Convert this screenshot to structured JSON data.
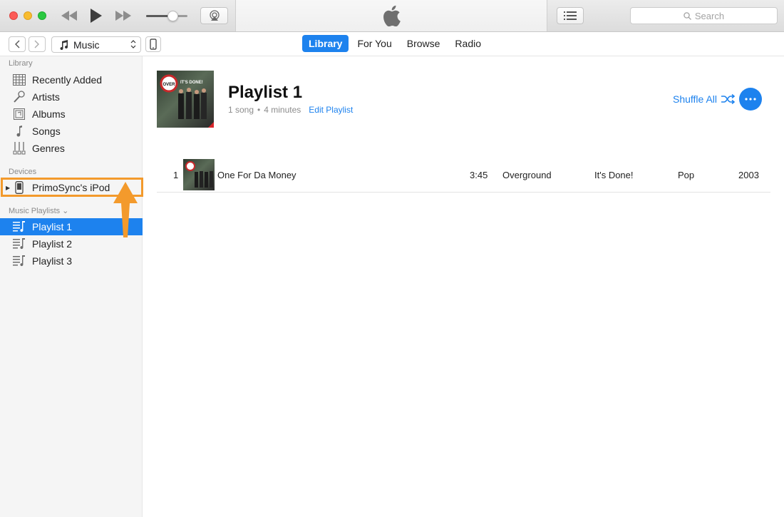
{
  "window": {
    "airplay_icon": "airplay-icon",
    "apple_logo": "apple-logo",
    "search": {
      "placeholder": "Search"
    }
  },
  "navbar": {
    "media_kind": "Music",
    "tabs": [
      {
        "label": "Library",
        "active": true
      },
      {
        "label": "For You",
        "active": false
      },
      {
        "label": "Browse",
        "active": false
      },
      {
        "label": "Radio",
        "active": false
      }
    ]
  },
  "sidebar": {
    "library_heading": "Library",
    "library_items": [
      {
        "label": "Recently Added",
        "icon": "grid-icon"
      },
      {
        "label": "Artists",
        "icon": "microphone-icon"
      },
      {
        "label": "Albums",
        "icon": "album-icon"
      },
      {
        "label": "Songs",
        "icon": "note-icon"
      },
      {
        "label": "Genres",
        "icon": "guitar-icon"
      }
    ],
    "devices_heading": "Devices",
    "device": {
      "label": "PrimoSync's iPod",
      "icon": "ipod-icon"
    },
    "playlists_heading": "Music Playlists ⌄",
    "playlists": [
      {
        "label": "Playlist 1",
        "selected": true
      },
      {
        "label": "Playlist 2",
        "selected": false
      },
      {
        "label": "Playlist 3",
        "selected": false
      }
    ]
  },
  "main": {
    "title": "Playlist 1",
    "song_count": "1 song",
    "duration": "4 minutes",
    "separator": "•",
    "edit_label": "Edit Playlist",
    "shuffle_label": "Shuffle All",
    "album_art_text_1": "OVER",
    "album_art_text_2": "IT'S DONE!",
    "tracks": [
      {
        "number": "1",
        "title": "One For Da Money",
        "time": "3:45",
        "artist": "Overground",
        "album": "It's Done!",
        "genre": "Pop",
        "year": "2003"
      }
    ]
  },
  "colors": {
    "accent": "#1d82ee",
    "annotation": "#f39a2c"
  }
}
